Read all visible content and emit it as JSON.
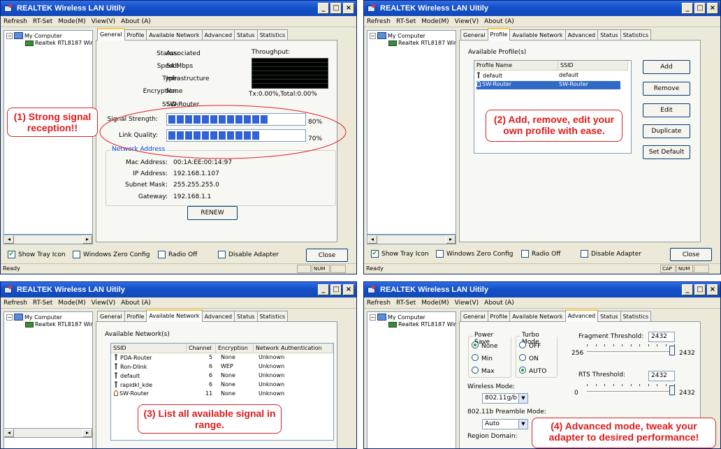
{
  "common": {
    "title": "REALTEK Wireless LAN Uitily",
    "menu": [
      "Refresh",
      "RT-Set",
      "Mode(M)",
      "View(V)",
      "About (A)"
    ],
    "tree_root": "My Computer",
    "tree_child": "Realtek RTL8187 Wir",
    "tabs": [
      "General",
      "Profile",
      "Available Network",
      "Advanced",
      "Status",
      "Statistics"
    ],
    "show_tray": "Show Tray Icon",
    "wzc": "Windows Zero Config",
    "radio_off": "Radio Off",
    "disable_adapter": "Disable Adapter",
    "close": "Close",
    "ready": "Ready",
    "num": "NUM",
    "cap": "CAP",
    "minimize": "_",
    "maximize": "□",
    "close_x": "×",
    "arrow_left": "◂",
    "arrow_right": "▸"
  },
  "general": {
    "status_label": "Status:",
    "status": "Associated",
    "speed_label": "Speed:",
    "speed": "54 Mbps",
    "type_label": "Type:",
    "type": "Infrastructure",
    "encryption_label": "Encryption:",
    "encryption": "None",
    "ssid_label": "SSID:",
    "ssid": "SW-Router",
    "throughput_label": "Throughput:",
    "tx": "Tx:0.00%,Total:0.00%",
    "signal_label": "Signal Strength:",
    "signal_value": "80%",
    "signal_fraction": 0.8,
    "link_label": "Link Quality:",
    "link_value": "70%",
    "link_fraction": 0.7,
    "net_address": "Network Address",
    "mac_label": "Mac Address:",
    "mac": "00:1A:EE:00:14:97",
    "ip_label": "IP Address:",
    "ip": "192.168.1.107",
    "mask_label": "Subnet Mask:",
    "mask": "255.255.255.0",
    "gw_label": "Gateway:",
    "gw": "192.168.1.1",
    "renew": "RENEW",
    "callout": "(1) Strong signal reception!!"
  },
  "profile": {
    "available": "Available Profile(s)",
    "col_name": "Profile Name",
    "col_ssid": "SSID",
    "rows": [
      {
        "name": "default",
        "ssid": "default"
      },
      {
        "name": "SW-Router",
        "ssid": "SW-Router"
      }
    ],
    "add": "Add",
    "remove": "Remove",
    "edit": "Edit",
    "duplicate": "Duplicate",
    "set_default": "Set Default",
    "callout": "(2) Add, remove, edit your own profile with ease."
  },
  "available_network": {
    "heading": "Available Network(s)",
    "headers": [
      "SSID",
      "Channel",
      "Encryption",
      "Network Authentication"
    ],
    "rows": [
      {
        "ssid": "PDA-Router",
        "channel": "5",
        "enc": "None",
        "auth": "Unknown"
      },
      {
        "ssid": "Ron-Dlink",
        "channel": "6",
        "enc": "WEP",
        "auth": "Unknown"
      },
      {
        "ssid": "default",
        "channel": "6",
        "enc": "None",
        "auth": "Unknown"
      },
      {
        "ssid": "rapidkl_kde",
        "channel": "6",
        "enc": "None",
        "auth": "Unknown"
      },
      {
        "ssid": "SW-Router",
        "channel": "11",
        "enc": "None",
        "auth": "Unknown"
      }
    ],
    "callout": "(3) List all available signal in range."
  },
  "advanced": {
    "power_save": "Power Save",
    "ps_options": [
      "None",
      "Min",
      "Max"
    ],
    "turbo": "Turbo Mode",
    "turbo_options": [
      "OFF",
      "ON",
      "AUTO"
    ],
    "frag_label": "Fragment Threshold:",
    "frag_value": "2432",
    "frag_min": "256",
    "frag_max": "2432",
    "rts_label": "RTS Threshold:",
    "rts_value": "2432",
    "rts_min": "0",
    "rts_max": "2432",
    "wireless_mode_label": "Wireless Mode:",
    "wireless_mode": "802.11g/b",
    "preamble_label": "802.11b Preamble Mode:",
    "preamble": "Auto",
    "region_label": "Region Domain:",
    "callout": "(4) Advanced mode, tweak your adapter to desired performance!"
  }
}
